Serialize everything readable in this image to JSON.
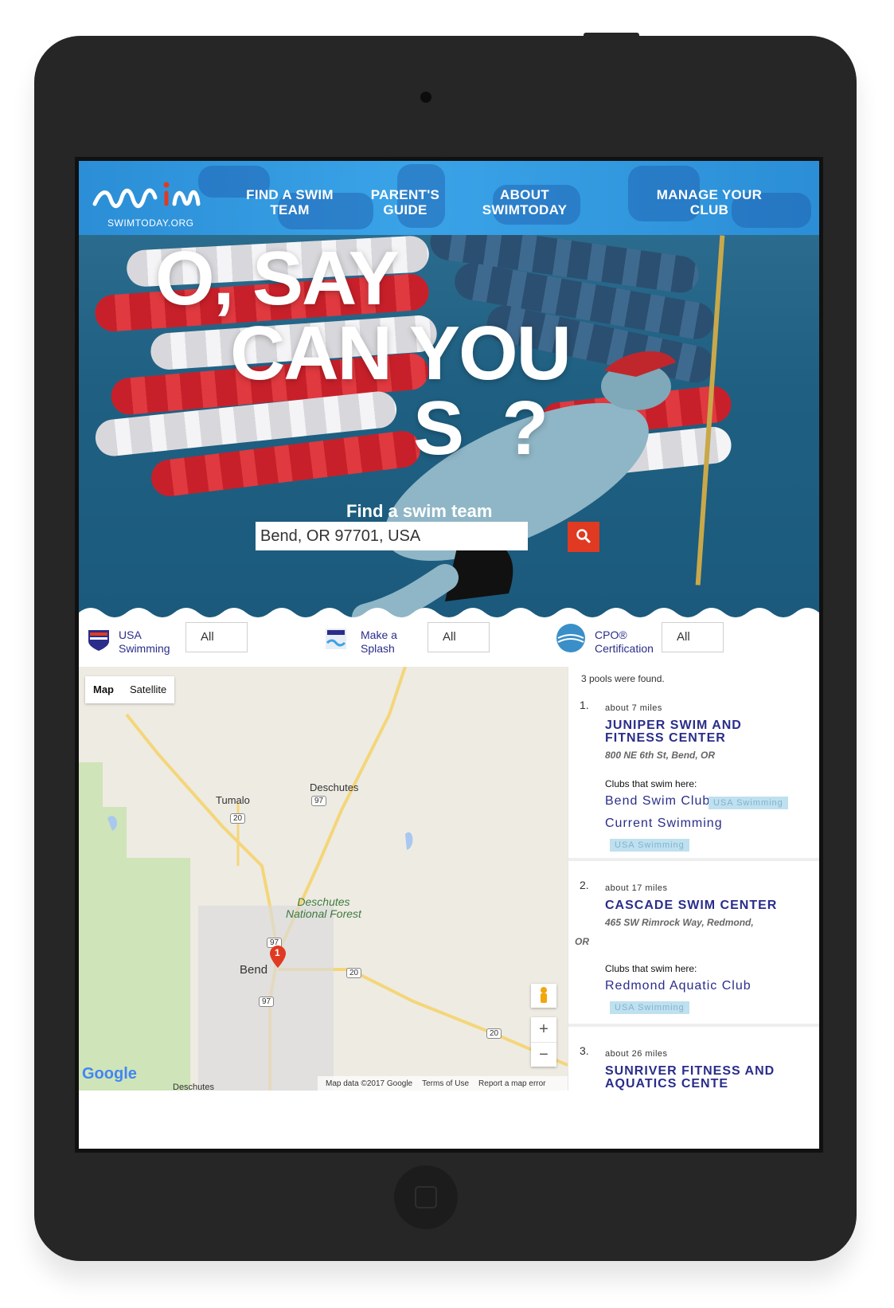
{
  "header": {
    "logo_text": "swim",
    "logo_sub": "SWIMTODAY.ORG",
    "nav": [
      {
        "line1": "FIND A SWIM",
        "line2": "TEAM"
      },
      {
        "line1": "PARENT'S",
        "line2": "GUIDE"
      },
      {
        "line1": "ABOUT",
        "line2": "SWIMTODAY"
      },
      {
        "line1": "MANAGE YOUR",
        "line2": "CLUB"
      }
    ]
  },
  "hero": {
    "title_line1": "O, SAY",
    "title_line2": "CAN YOU",
    "title_line3": "S  ?",
    "search_label": "Find a swim team",
    "search_value": "Bend, OR 97701, USA"
  },
  "filters": [
    {
      "label_line1": "USA",
      "label_line2": "Swimming",
      "value": "All",
      "icon": "usa-swimming-logo-icon"
    },
    {
      "label_line1": "Make a",
      "label_line2": "Splash",
      "value": "All",
      "icon": "make-a-splash-logo-icon"
    },
    {
      "label_line1": "CPO®",
      "label_line2": "Certification",
      "value": "All",
      "icon": "cpo-globe-icon"
    }
  ],
  "map": {
    "tab_map": "Map",
    "tab_satellite": "Satellite",
    "labels": {
      "tumalo": "Tumalo",
      "deschutes": "Deschutes",
      "bend": "Bend",
      "deschutes_bottom": "Deschutes"
    },
    "forest_line1": "Deschutes",
    "forest_line2": "National Forest",
    "shields": {
      "r97a": "97",
      "r20a": "20",
      "r20b": "20",
      "r97b": "97",
      "r20c": "20",
      "r97c": "97"
    },
    "marker_label": "1",
    "zoom_in": "+",
    "zoom_out": "−",
    "google": "Google",
    "footer": {
      "data": "Map data ©2017 Google",
      "terms": "Terms of Use",
      "report": "Report a map error"
    }
  },
  "results": {
    "found_text": "3 pools were found.",
    "items": [
      {
        "num": "1.",
        "distance": "about 7 miles",
        "name_line1": "JUNIPER SWIM AND",
        "name_line2": "FITNESS CENTER",
        "address": "800 NE 6th St, Bend, OR",
        "clubs_label": "Clubs that swim here:",
        "clubs": [
          {
            "name": "Bend Swim Club",
            "tag": "USA Swimming"
          },
          {
            "name": "Current Swimming",
            "tag": "USA Swimming"
          }
        ]
      },
      {
        "num": "2.",
        "distance": "about 17 miles",
        "name_line1": "CASCADE SWIM CENTER",
        "address": "465 SW Rimrock Way, Redmond,",
        "address_or": "OR",
        "clubs_label": "Clubs that swim here:",
        "clubs": [
          {
            "name": "Redmond Aquatic Club",
            "tag": "USA Swimming"
          }
        ]
      },
      {
        "num": "3.",
        "distance": "about 26 miles",
        "name_line1": "SUNRIVER FITNESS AND",
        "name_line2": "AQUATICS CENTE"
      }
    ]
  }
}
